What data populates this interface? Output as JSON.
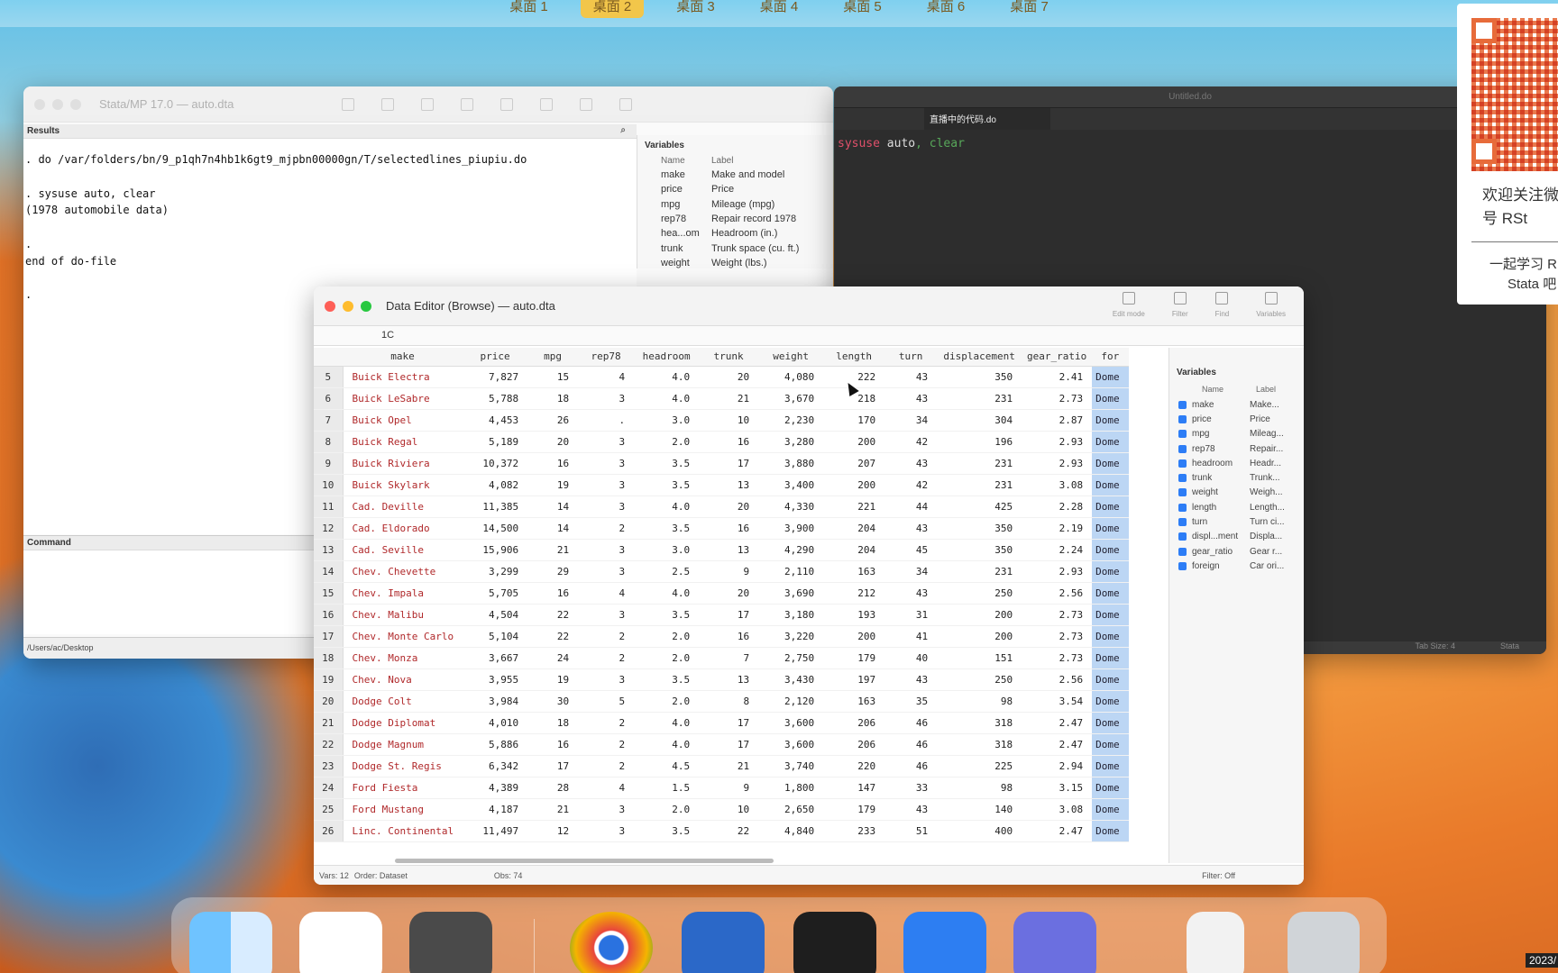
{
  "spaces": [
    "桌面 1",
    "桌面 2",
    "桌面 3",
    "桌面 4",
    "桌面 5",
    "桌面 6",
    "桌面 7"
  ],
  "stata_main": {
    "title": "Stata/MP 17.0 — auto.dta",
    "results_label": "Results",
    "results_text": ". do /var/folders/bn/9_p1qh7n4hb1k6gt9_mjpbn00000gn/T/selectedlines_piupiu.do\n\n. sysuse auto, clear\n(1978 automobile data)\n\n.\nend of do-file\n\n.",
    "command_label": "Command",
    "cwd": "/Users/ac/Desktop",
    "variables_label": "Variables",
    "col_name": "Name",
    "col_label": "Label",
    "variables": [
      {
        "name": "make",
        "label": "Make and model"
      },
      {
        "name": "price",
        "label": "Price"
      },
      {
        "name": "mpg",
        "label": "Mileage (mpg)"
      },
      {
        "name": "rep78",
        "label": "Repair record 1978"
      },
      {
        "name": "hea...om",
        "label": "Headroom (in.)"
      },
      {
        "name": "trunk",
        "label": "Trunk space (cu. ft.)"
      },
      {
        "name": "weight",
        "label": "Weight (lbs.)"
      }
    ]
  },
  "do_editor": {
    "title": "Untitled.do",
    "tab_label": "直播中的代码.do",
    "code_kw": "sysuse",
    "code_arg": "auto",
    "code_opt": ", clear",
    "status_left": "Tab Size: 4",
    "status_right": "Stata"
  },
  "data_editor": {
    "title": "Data Editor (Browse) — auto.dta",
    "tools": [
      "Edit mode",
      "Filter",
      "Find",
      "Variables"
    ],
    "cell_value": "1C",
    "columns": [
      "make",
      "price",
      "mpg",
      "rep78",
      "headroom",
      "trunk",
      "weight",
      "length",
      "turn",
      "displacement",
      "gear_ratio",
      "for"
    ],
    "rows": [
      [
        "5",
        "Buick Electra",
        "7,827",
        "15",
        "4",
        "4.0",
        "20",
        "4,080",
        "222",
        "43",
        "350",
        "2.41",
        "Dome"
      ],
      [
        "6",
        "Buick LeSabre",
        "5,788",
        "18",
        "3",
        "4.0",
        "21",
        "3,670",
        "218",
        "43",
        "231",
        "2.73",
        "Dome"
      ],
      [
        "7",
        "Buick Opel",
        "4,453",
        "26",
        ".",
        "3.0",
        "10",
        "2,230",
        "170",
        "34",
        "304",
        "2.87",
        "Dome"
      ],
      [
        "8",
        "Buick Regal",
        "5,189",
        "20",
        "3",
        "2.0",
        "16",
        "3,280",
        "200",
        "42",
        "196",
        "2.93",
        "Dome"
      ],
      [
        "9",
        "Buick Riviera",
        "10,372",
        "16",
        "3",
        "3.5",
        "17",
        "3,880",
        "207",
        "43",
        "231",
        "2.93",
        "Dome"
      ],
      [
        "10",
        "Buick Skylark",
        "4,082",
        "19",
        "3",
        "3.5",
        "13",
        "3,400",
        "200",
        "42",
        "231",
        "3.08",
        "Dome"
      ],
      [
        "11",
        "Cad. Deville",
        "11,385",
        "14",
        "3",
        "4.0",
        "20",
        "4,330",
        "221",
        "44",
        "425",
        "2.28",
        "Dome"
      ],
      [
        "12",
        "Cad. Eldorado",
        "14,500",
        "14",
        "2",
        "3.5",
        "16",
        "3,900",
        "204",
        "43",
        "350",
        "2.19",
        "Dome"
      ],
      [
        "13",
        "Cad. Seville",
        "15,906",
        "21",
        "3",
        "3.0",
        "13",
        "4,290",
        "204",
        "45",
        "350",
        "2.24",
        "Dome"
      ],
      [
        "14",
        "Chev. Chevette",
        "3,299",
        "29",
        "3",
        "2.5",
        "9",
        "2,110",
        "163",
        "34",
        "231",
        "2.93",
        "Dome"
      ],
      [
        "15",
        "Chev. Impala",
        "5,705",
        "16",
        "4",
        "4.0",
        "20",
        "3,690",
        "212",
        "43",
        "250",
        "2.56",
        "Dome"
      ],
      [
        "16",
        "Chev. Malibu",
        "4,504",
        "22",
        "3",
        "3.5",
        "17",
        "3,180",
        "193",
        "31",
        "200",
        "2.73",
        "Dome"
      ],
      [
        "17",
        "Chev. Monte Carlo",
        "5,104",
        "22",
        "2",
        "2.0",
        "16",
        "3,220",
        "200",
        "41",
        "200",
        "2.73",
        "Dome"
      ],
      [
        "18",
        "Chev. Monza",
        "3,667",
        "24",
        "2",
        "2.0",
        "7",
        "2,750",
        "179",
        "40",
        "151",
        "2.73",
        "Dome"
      ],
      [
        "19",
        "Chev. Nova",
        "3,955",
        "19",
        "3",
        "3.5",
        "13",
        "3,430",
        "197",
        "43",
        "250",
        "2.56",
        "Dome"
      ],
      [
        "20",
        "Dodge Colt",
        "3,984",
        "30",
        "5",
        "2.0",
        "8",
        "2,120",
        "163",
        "35",
        "98",
        "3.54",
        "Dome"
      ],
      [
        "21",
        "Dodge Diplomat",
        "4,010",
        "18",
        "2",
        "4.0",
        "17",
        "3,600",
        "206",
        "46",
        "318",
        "2.47",
        "Dome"
      ],
      [
        "22",
        "Dodge Magnum",
        "5,886",
        "16",
        "2",
        "4.0",
        "17",
        "3,600",
        "206",
        "46",
        "318",
        "2.47",
        "Dome"
      ],
      [
        "23",
        "Dodge St. Regis",
        "6,342",
        "17",
        "2",
        "4.5",
        "21",
        "3,740",
        "220",
        "46",
        "225",
        "2.94",
        "Dome"
      ],
      [
        "24",
        "Ford Fiesta",
        "4,389",
        "28",
        "4",
        "1.5",
        "9",
        "1,800",
        "147",
        "33",
        "98",
        "3.15",
        "Dome"
      ],
      [
        "25",
        "Ford Mustang",
        "4,187",
        "21",
        "3",
        "2.0",
        "10",
        "2,650",
        "179",
        "43",
        "140",
        "3.08",
        "Dome"
      ],
      [
        "26",
        "Linc. Continental",
        "11,497",
        "12",
        "3",
        "3.5",
        "22",
        "4,840",
        "233",
        "51",
        "400",
        "2.47",
        "Dome"
      ]
    ],
    "variables_label": "Variables",
    "col_name": "Name",
    "col_label": "Label",
    "variables": [
      {
        "name": "make",
        "label": "Make..."
      },
      {
        "name": "price",
        "label": "Price"
      },
      {
        "name": "mpg",
        "label": "Mileag..."
      },
      {
        "name": "rep78",
        "label": "Repair..."
      },
      {
        "name": "headroom",
        "label": "Headr..."
      },
      {
        "name": "trunk",
        "label": "Trunk..."
      },
      {
        "name": "weight",
        "label": "Weigh..."
      },
      {
        "name": "length",
        "label": "Length..."
      },
      {
        "name": "turn",
        "label": "Turn ci..."
      },
      {
        "name": "displ...ment",
        "label": "Displa..."
      },
      {
        "name": "gear_ratio",
        "label": "Gear r..."
      },
      {
        "name": "foreign",
        "label": "Car ori..."
      }
    ],
    "status_vars": "Vars: 12",
    "status_order": "Order: Dataset",
    "status_obs": "Obs: 74",
    "status_filter": "Filter: Off"
  },
  "qr_card": {
    "line1": "欢迎关注微",
    "line2": "号 RSt",
    "line3": "一起学习 R",
    "line4": "Stata 吧"
  },
  "clock": "2023/",
  "colors": {
    "accent": "#f2c64a",
    "make_text": "#b0282a",
    "foreign_bg": "#bcd6f4"
  }
}
